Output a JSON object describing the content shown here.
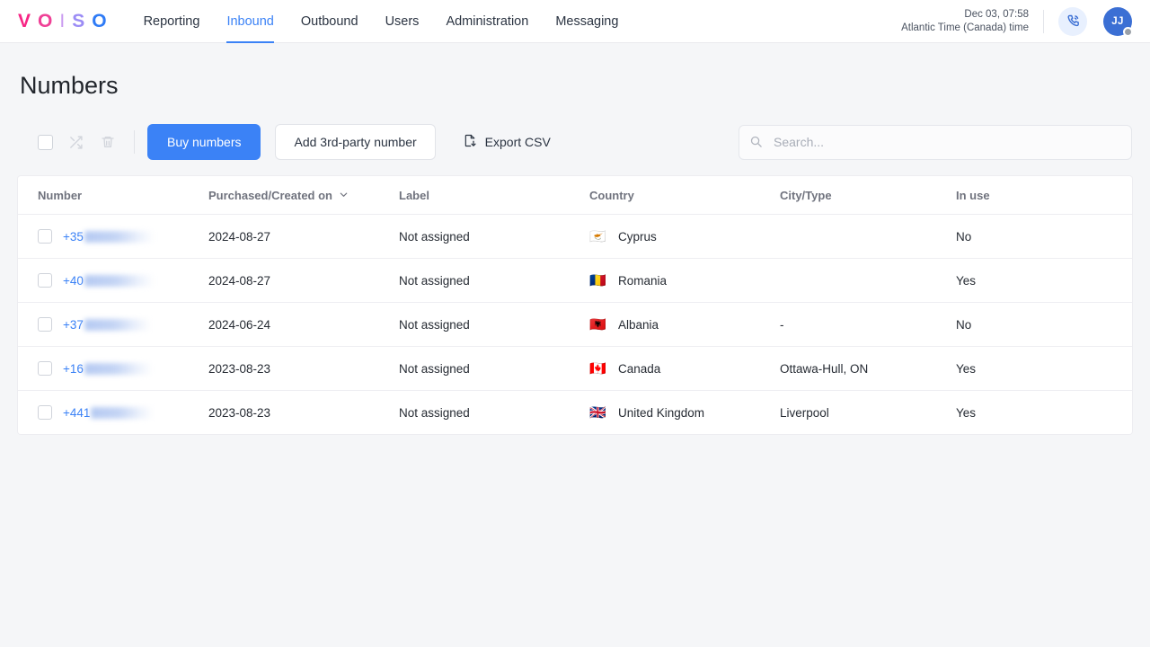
{
  "brand": {
    "letters": [
      "V",
      "O",
      "I",
      "S",
      "O"
    ],
    "accent": "#3b82f6"
  },
  "nav": {
    "items": [
      {
        "label": "Reporting",
        "active": false
      },
      {
        "label": "Inbound",
        "active": true
      },
      {
        "label": "Outbound",
        "active": false
      },
      {
        "label": "Users",
        "active": false
      },
      {
        "label": "Administration",
        "active": false
      },
      {
        "label": "Messaging",
        "active": false
      }
    ]
  },
  "header_right": {
    "datetime": "Dec 03, 07:58",
    "timezone": "Atlantic Time (Canada) time",
    "phone_icon": "phone-ringing-icon",
    "avatar_initials": "JJ",
    "avatar_status": "away"
  },
  "page": {
    "title": "Numbers"
  },
  "toolbar": {
    "select_all_checkbox": "",
    "shuffle_icon": "shuffle-icon",
    "delete_icon": "trash-icon",
    "buy_label": "Buy numbers",
    "third_party_label": "Add 3rd-party number",
    "export_label": "Export CSV",
    "export_icon": "file-download-icon"
  },
  "search": {
    "value": "",
    "placeholder": "Search...",
    "icon": "search-icon"
  },
  "table": {
    "columns": [
      {
        "key": "number",
        "label": "Number",
        "sortable": false
      },
      {
        "key": "date",
        "label": "Purchased/Created on",
        "sortable": true
      },
      {
        "key": "label",
        "label": "Label",
        "sortable": false
      },
      {
        "key": "country",
        "label": "Country",
        "sortable": false
      },
      {
        "key": "city",
        "label": "City/Type",
        "sortable": false
      },
      {
        "key": "inuse",
        "label": "In use",
        "sortable": false
      }
    ],
    "sort": {
      "column": "Purchased/Created on",
      "icon": "chevron-down-icon"
    },
    "rows": [
      {
        "prefix": "+35",
        "redacted_width": 78,
        "date": "2024-08-27",
        "label": "Not assigned",
        "flag": "🇨🇾",
        "country": "Cyprus",
        "city": "",
        "inuse": "No"
      },
      {
        "prefix": "+40",
        "redacted_width": 78,
        "date": "2024-08-27",
        "label": "Not assigned",
        "flag": "🇷🇴",
        "country": "Romania",
        "city": "",
        "inuse": "Yes"
      },
      {
        "prefix": "+37",
        "redacted_width": 74,
        "date": "2024-06-24",
        "label": "Not assigned",
        "flag": "🇦🇱",
        "country": "Albania",
        "city": "-",
        "inuse": "No"
      },
      {
        "prefix": "+16",
        "redacted_width": 76,
        "date": "2023-08-23",
        "label": "Not assigned",
        "flag": "🇨🇦",
        "country": "Canada",
        "city": "Ottawa-Hull, ON",
        "inuse": "Yes"
      },
      {
        "prefix": "+441",
        "redacted_width": 70,
        "date": "2023-08-23",
        "label": "Not assigned",
        "flag": "🇬🇧",
        "country": "United Kingdom",
        "city": "Liverpool",
        "inuse": "Yes"
      }
    ]
  }
}
